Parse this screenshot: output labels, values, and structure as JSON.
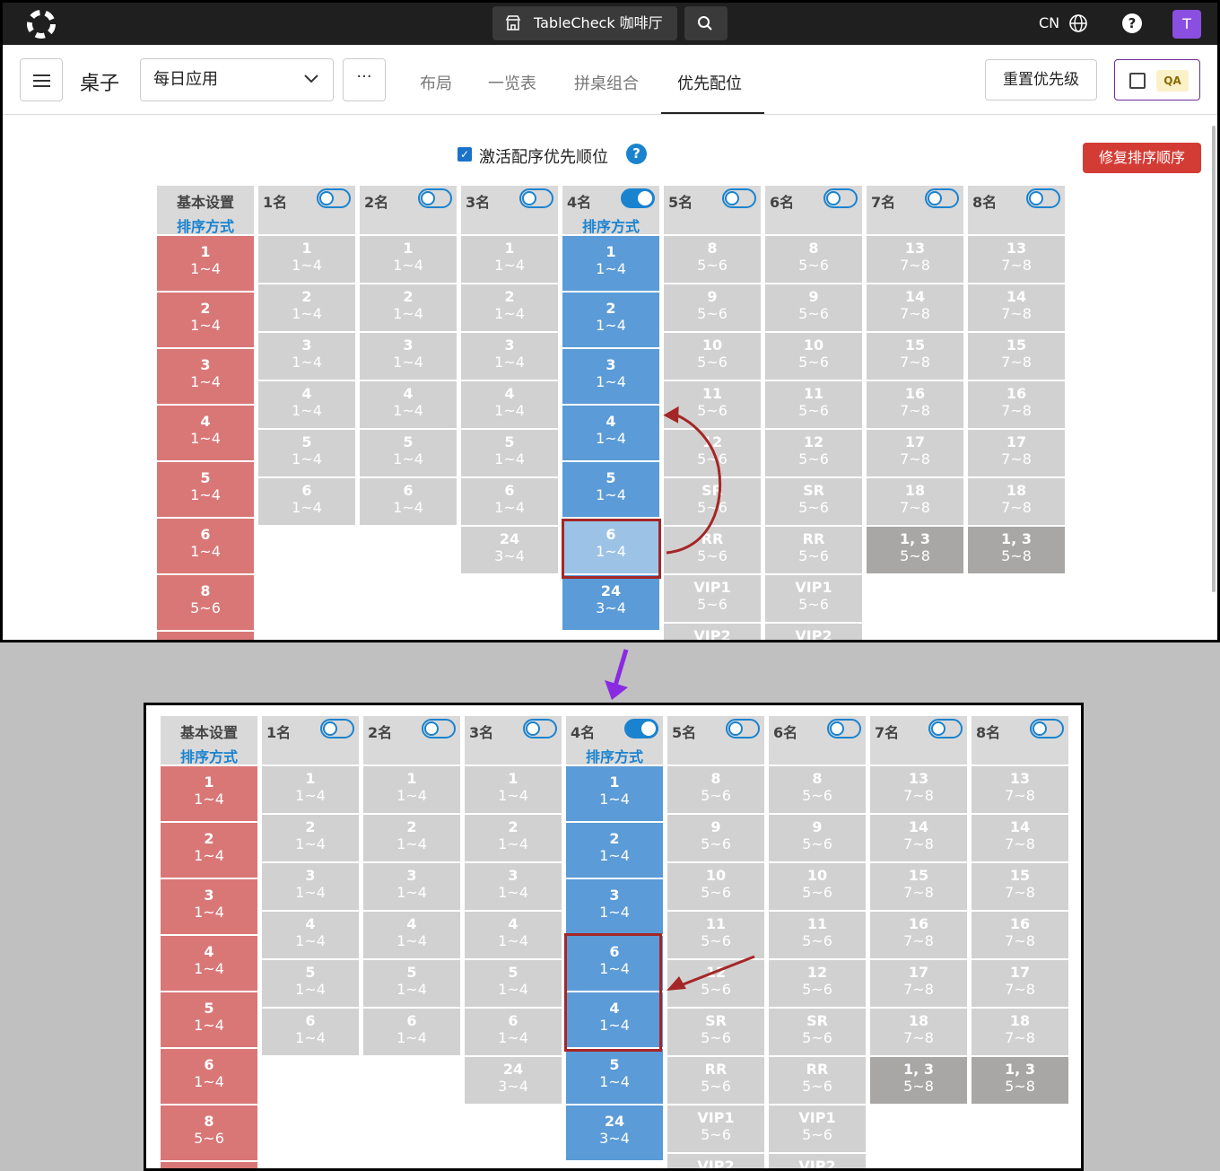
{
  "topbar": {
    "store": "TableCheck 咖啡厅",
    "lang": "CN",
    "avatar": "T"
  },
  "subbar": {
    "title": "桌子",
    "select_value": "每日应用",
    "more": "···",
    "tabs": [
      "布局",
      "一览表",
      "拼桌组合",
      "优先配位"
    ],
    "reset": "重置优先级",
    "qa": "QA"
  },
  "activate_label": "激活配序优先顺位",
  "fix_button": "修复排序顺序",
  "columns": [
    {
      "name": "基本设置",
      "sort": "排序方式"
    },
    {
      "name": "1名",
      "toggle": "off"
    },
    {
      "name": "2名",
      "toggle": "off"
    },
    {
      "name": "3名",
      "toggle": "off"
    },
    {
      "name": "4名",
      "toggle": "on",
      "sort": "排序方式"
    },
    {
      "name": "5名",
      "toggle": "off"
    },
    {
      "name": "6名",
      "toggle": "off"
    },
    {
      "name": "7名",
      "toggle": "off"
    },
    {
      "name": "8名",
      "toggle": "off"
    }
  ],
  "top_cells": {
    "c0": [
      [
        "1",
        "1~4"
      ],
      [
        "2",
        "1~4"
      ],
      [
        "3",
        "1~4"
      ],
      [
        "4",
        "1~4"
      ],
      [
        "5",
        "1~4"
      ],
      [
        "6",
        "1~4"
      ],
      [
        "8",
        "5~6"
      ],
      [
        "",
        ""
      ]
    ],
    "c1": [
      [
        "1",
        "1~4"
      ],
      [
        "2",
        "1~4"
      ],
      [
        "3",
        "1~4"
      ],
      [
        "4",
        "1~4"
      ],
      [
        "5",
        "1~4"
      ],
      [
        "6",
        "1~4"
      ]
    ],
    "c2": [
      [
        "1",
        "1~4"
      ],
      [
        "2",
        "1~4"
      ],
      [
        "3",
        "1~4"
      ],
      [
        "4",
        "1~4"
      ],
      [
        "5",
        "1~4"
      ],
      [
        "6",
        "1~4"
      ]
    ],
    "c3": [
      [
        "1",
        "1~4"
      ],
      [
        "2",
        "1~4"
      ],
      [
        "3",
        "1~4"
      ],
      [
        "4",
        "1~4"
      ],
      [
        "5",
        "1~4"
      ],
      [
        "6",
        "1~4"
      ],
      [
        "24",
        "3~4"
      ]
    ],
    "c4": [
      [
        "1",
        "1~4"
      ],
      [
        "2",
        "1~4"
      ],
      [
        "3",
        "1~4"
      ],
      [
        "4",
        "1~4"
      ],
      [
        "5",
        "1~4"
      ],
      [
        "6",
        "1~4"
      ],
      [
        "24",
        "3~4"
      ]
    ],
    "c5": [
      [
        "8",
        "5~6"
      ],
      [
        "9",
        "5~6"
      ],
      [
        "10",
        "5~6"
      ],
      [
        "11",
        "5~6"
      ],
      [
        "12",
        "5~6"
      ],
      [
        "SR",
        "5~6"
      ],
      [
        "RR",
        "5~6"
      ],
      [
        "VIP1",
        "5~6"
      ],
      [
        "VIP2",
        ""
      ]
    ],
    "c6": [
      [
        "8",
        "5~6"
      ],
      [
        "9",
        "5~6"
      ],
      [
        "10",
        "5~6"
      ],
      [
        "11",
        "5~6"
      ],
      [
        "12",
        "5~6"
      ],
      [
        "SR",
        "5~6"
      ],
      [
        "RR",
        "5~6"
      ],
      [
        "VIP1",
        "5~6"
      ],
      [
        "VIP2",
        ""
      ]
    ],
    "c7": [
      [
        "13",
        "7~8"
      ],
      [
        "14",
        "7~8"
      ],
      [
        "15",
        "7~8"
      ],
      [
        "16",
        "7~8"
      ],
      [
        "17",
        "7~8"
      ],
      [
        "18",
        "7~8"
      ],
      [
        "1, 3",
        "5~8"
      ]
    ],
    "c8": [
      [
        "13",
        "7~8"
      ],
      [
        "14",
        "7~8"
      ],
      [
        "15",
        "7~8"
      ],
      [
        "16",
        "7~8"
      ],
      [
        "17",
        "7~8"
      ],
      [
        "18",
        "7~8"
      ],
      [
        "1, 3",
        "5~8"
      ]
    ]
  },
  "bottom_c4": [
    [
      "1",
      "1~4"
    ],
    [
      "2",
      "1~4"
    ],
    [
      "3",
      "1~4"
    ],
    [
      "6",
      "1~4"
    ],
    [
      "4",
      "1~4"
    ],
    [
      "5",
      "1~4"
    ],
    [
      "24",
      "3~4"
    ]
  ]
}
